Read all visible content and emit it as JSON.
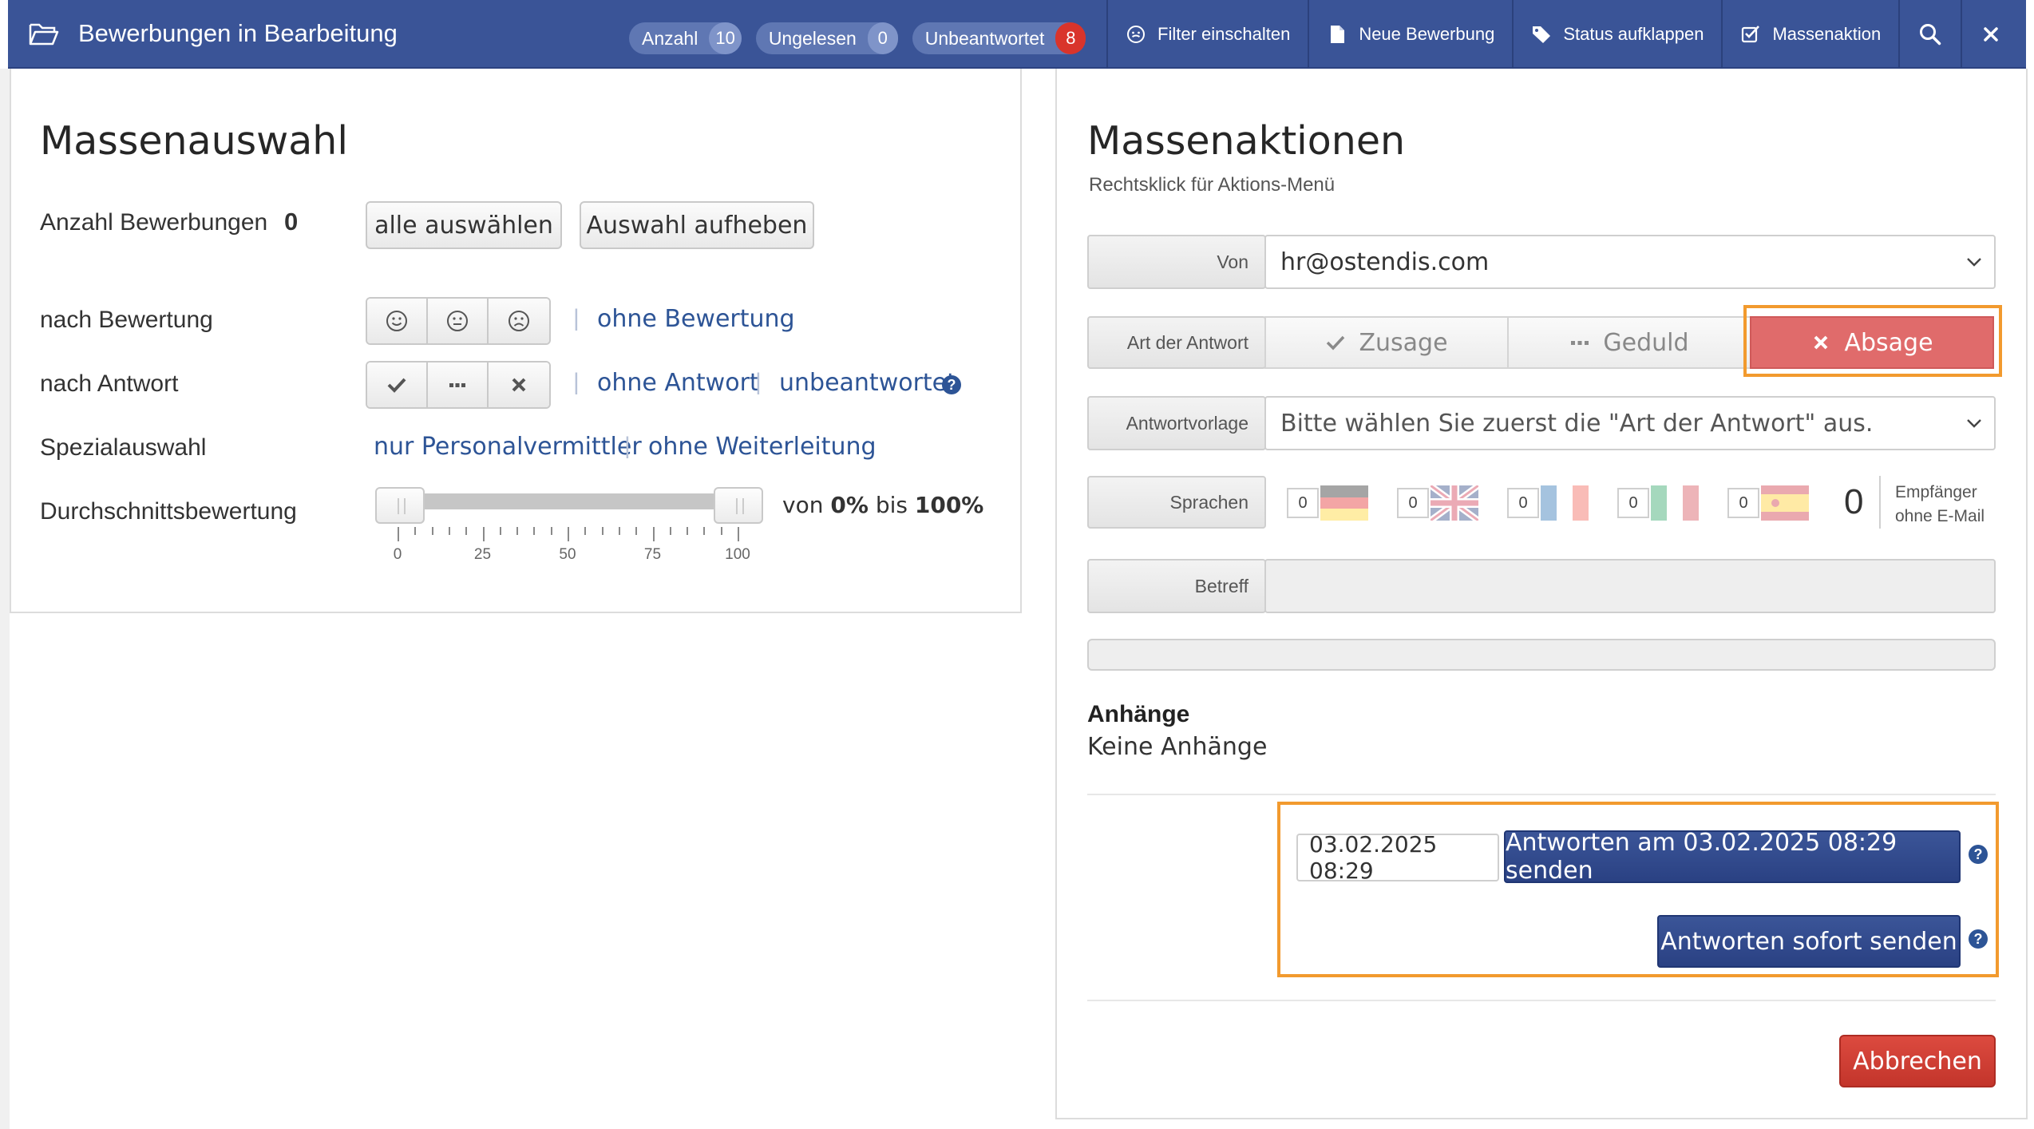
{
  "topbar": {
    "title": "Bewerbungen in Bearbeitung",
    "badges": [
      {
        "label": "Anzahl",
        "count": "10",
        "color": "#7f94c9"
      },
      {
        "label": "Ungelesen",
        "count": "0",
        "color": "#7f94c9"
      },
      {
        "label": "Unbeantwortet",
        "count": "8",
        "color": "#d9342b"
      }
    ],
    "actions": {
      "filter": "Filter einschalten",
      "new": "Neue Bewerbung",
      "status": "Status aufklappen",
      "mass": "Massenaktion"
    }
  },
  "left": {
    "title": "Massenauswahl",
    "count_label": "Anzahl Bewerbungen",
    "count_value": "0",
    "select_all": "alle auswählen",
    "deselect": "Auswahl aufheben",
    "by_rating": "nach Bewertung",
    "without_rating": "ohne Bewertung",
    "by_answer": "nach Antwort",
    "without_answer": "ohne Antwort",
    "unanswered": "unbeantwortet",
    "special": "Spezialauswahl",
    "only_agencies": "nur Personalvermittler",
    "without_forward": "ohne Weiterleitung",
    "avg_rating": "Durchschnittsbewertung",
    "range_from_label": "von",
    "range_from": "0%",
    "range_to_label": "bis",
    "range_to": "100%",
    "slider_min": 0,
    "slider_max": 100,
    "ticks": [
      "0",
      "25",
      "50",
      "75",
      "100"
    ]
  },
  "right": {
    "title": "Massenaktionen",
    "subtitle": "Rechtsklick für Aktions-Menü",
    "from_label": "Von",
    "from_value": "hr@ostendis.com",
    "answer_type_label": "Art der Antwort",
    "answer_accept": "Zusage",
    "answer_patience": "Geduld",
    "answer_reject": "Absage",
    "template_label": "Antwortvorlage",
    "template_value": "Bitte wählen Sie zuerst die \"Art der Antwort\" aus.",
    "languages_label": "Sprachen",
    "languages": [
      {
        "code": "de",
        "count": "0"
      },
      {
        "code": "en",
        "count": "0"
      },
      {
        "code": "fr",
        "count": "0"
      },
      {
        "code": "it",
        "count": "0"
      },
      {
        "code": "es",
        "count": "0"
      }
    ],
    "no_email_count": "0",
    "no_email_label_1": "Empfänger",
    "no_email_label_2": "ohne E-Mail",
    "subject_label": "Betreff",
    "subject_value": "",
    "attachments_title": "Anhänge",
    "attachments_value": "Keine Anhänge",
    "schedule_value": "03.02.2025 08:29",
    "schedule_button": "Antworten am 03.02.2025 08:29 senden",
    "send_now_button": "Antworten sofort senden",
    "cancel_button": "Abbrechen"
  },
  "colors": {
    "topbar": "#3a5497",
    "link": "#2d5496",
    "reject_active": "#e06b6b",
    "primary": "#2a4183",
    "danger": "#c3352b",
    "highlight": "#f29a2e"
  }
}
